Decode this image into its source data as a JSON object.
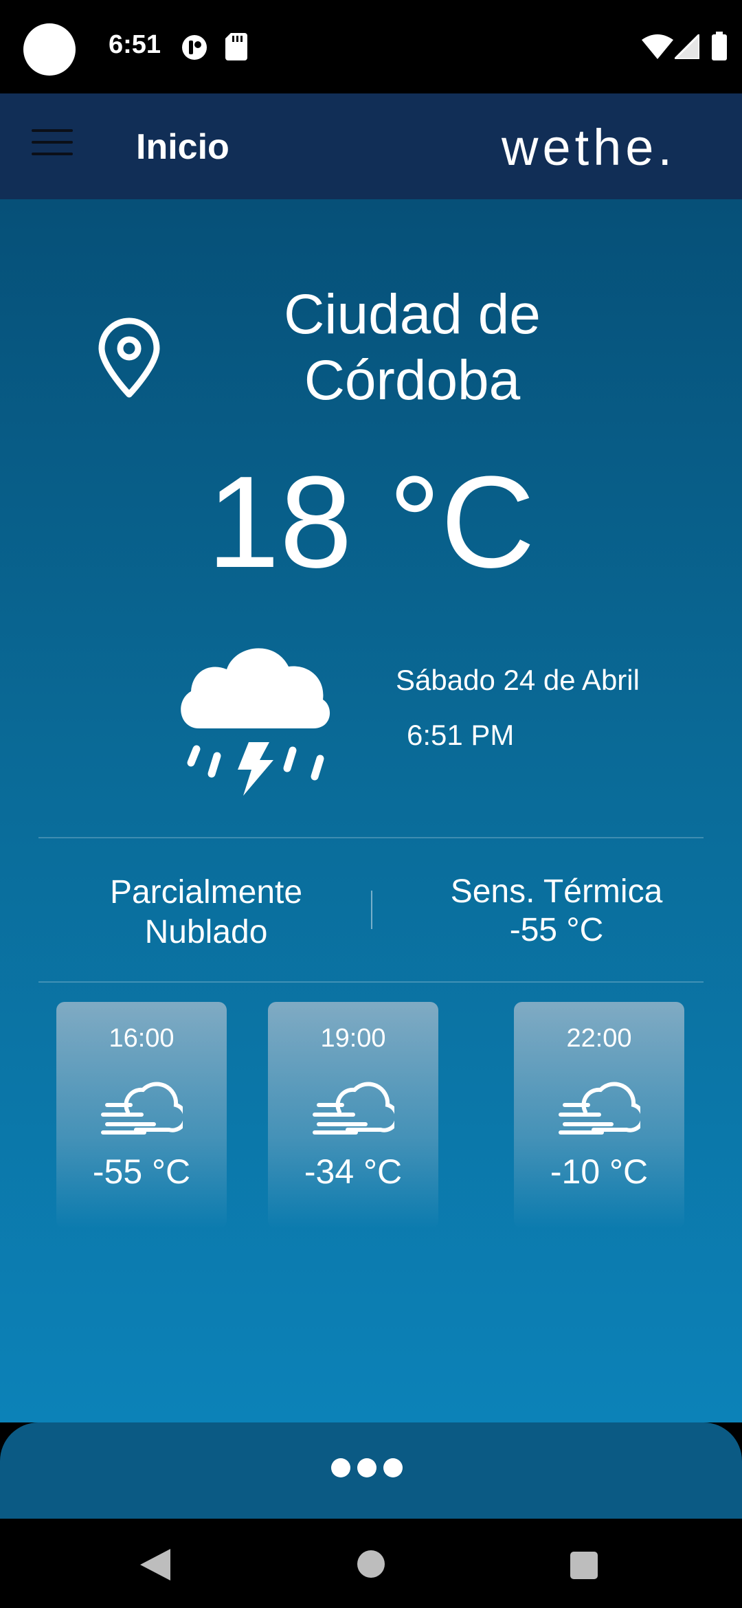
{
  "status_bar": {
    "time": "6:51",
    "icons": [
      "camera-cutout",
      "notification-icon",
      "sd-card-icon",
      "wifi-icon",
      "signal-icon",
      "battery-icon"
    ]
  },
  "app_bar": {
    "title": "Inicio",
    "brand": "wethe.",
    "menu_icon": "hamburger-menu-icon"
  },
  "weather": {
    "city": "Ciudad de Córdoba",
    "temperature": "18 °C",
    "date": "Sábado 24 de Abril",
    "time": "6:51 PM",
    "condition": "Parcialmente Nublado",
    "feels_label": "Sens. Térmica",
    "feels_value": "-55 °C",
    "main_icon": "thunderstorm-icon",
    "location_icon": "location-pin-icon"
  },
  "hourly": [
    {
      "hour": "16:00",
      "temp": "-55 °C",
      "icon": "windy-cloud-icon"
    },
    {
      "hour": "19:00",
      "temp": "-34 °C",
      "icon": "windy-cloud-icon"
    },
    {
      "hour": "22:00",
      "temp": "-10 °C",
      "icon": "windy-cloud-icon"
    }
  ],
  "bottom_bar": {
    "icon": "more-dots-icon"
  },
  "nav_bar": {
    "icons": [
      "back-icon",
      "home-icon",
      "recents-icon"
    ]
  },
  "colors": {
    "app_bar": "#112e56",
    "content_top": "#065078",
    "content_bottom": "#0c82b8",
    "more_bar": "#0b5a84"
  }
}
